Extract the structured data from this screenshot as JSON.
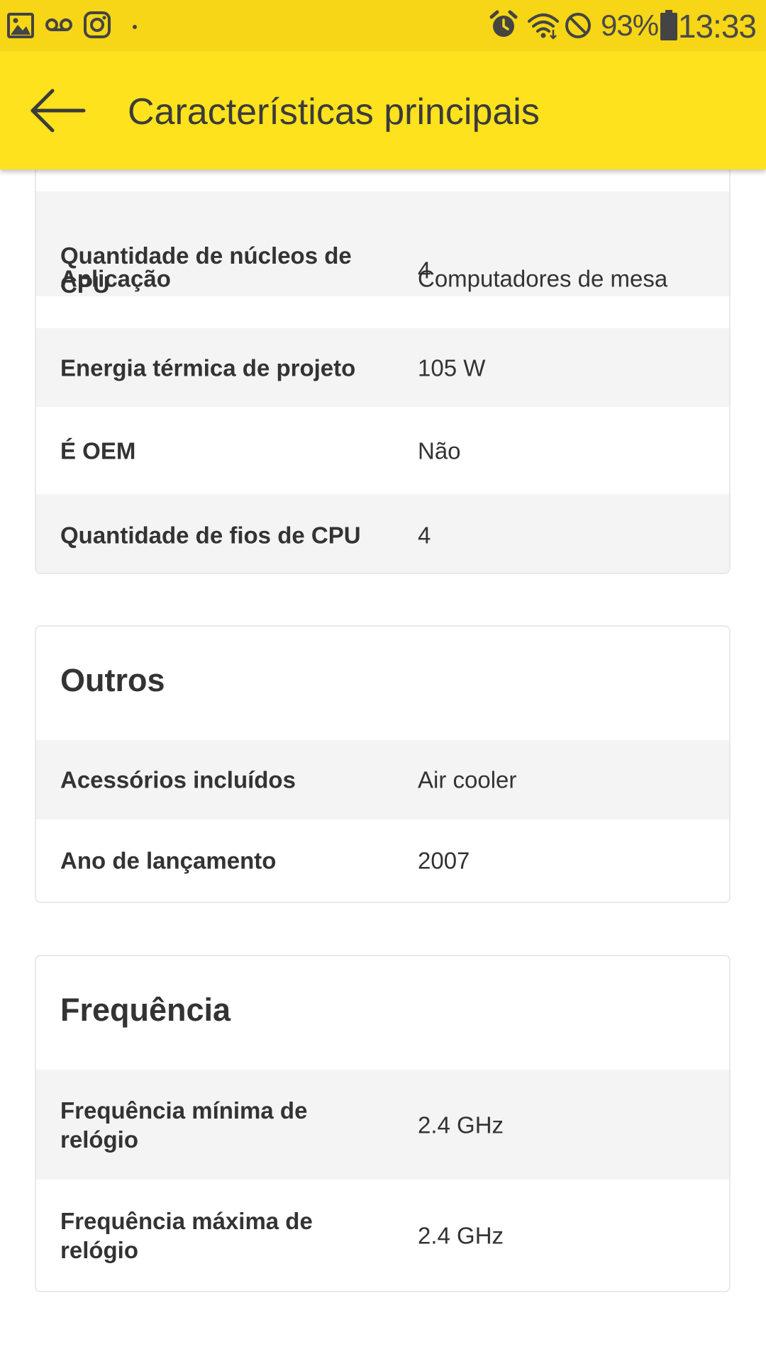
{
  "status_bar": {
    "time": "13:33",
    "battery_percent": "93%",
    "left_icons": [
      "image-icon",
      "voicemail-icon",
      "instagram-icon",
      "dot-icon"
    ],
    "right_icons": [
      "alarm-icon",
      "wifi-icon",
      "do-not-disturb-icon",
      "battery-icon"
    ]
  },
  "toolbar": {
    "title": "Características principais",
    "back_icon": "arrow-left-icon"
  },
  "main_specs": {
    "rows": [
      {
        "key": "Aplicação",
        "value": "Computadores de mesa"
      },
      {
        "key": "Quantidade de núcleos de CPU",
        "value": "4"
      },
      {
        "key": "Energia térmica de projeto",
        "value": "105 W"
      },
      {
        "key": "É OEM",
        "value": "Não"
      },
      {
        "key": "Quantidade de fios de CPU",
        "value": "4"
      }
    ]
  },
  "outros": {
    "title": "Outros",
    "rows": [
      {
        "key": "Acessórios incluídos",
        "value": "Air cooler"
      },
      {
        "key": "Ano de lançamento",
        "value": "2007"
      }
    ]
  },
  "frequencia": {
    "title": "Frequência",
    "rows": [
      {
        "key": "Frequência mínima de relógio",
        "value": "2.4 GHz"
      },
      {
        "key": "Frequência máxima de relógio",
        "value": "2.4 GHz"
      }
    ]
  },
  "colors": {
    "toolbar": "#fde21d",
    "status_bar": "#f6d616",
    "row_alt": "#f4f4f4",
    "text": "#333333"
  }
}
